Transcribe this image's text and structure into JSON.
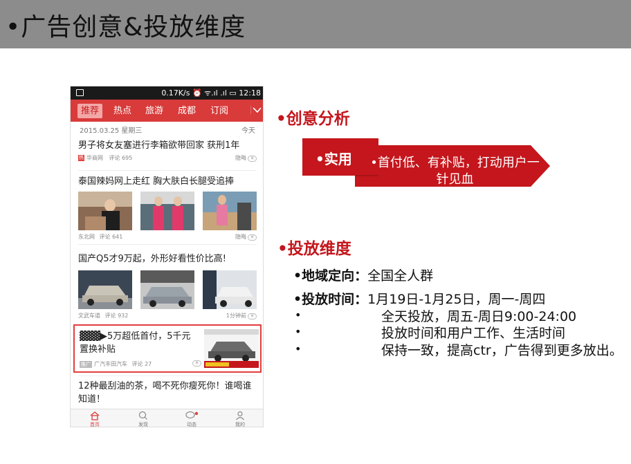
{
  "slide": {
    "title": "•广告创意&投放维度"
  },
  "phone": {
    "status": {
      "text": "0.17K/s ⏰ ᯤ.ıl .ıl ▭ 12:18"
    },
    "nav_tabs": [
      "推荐",
      "热点",
      "旅游",
      "成都",
      "订阅"
    ],
    "date_left": "2015.03.25   星期三",
    "date_right": "今天",
    "news": [
      {
        "title": "男子将女友塞进行李箱欲带回家 获刑1年",
        "source": "华商网",
        "comments": "评论 695",
        "tag": "热",
        "right": "隐晦"
      },
      {
        "title": "泰国辣妈网上走红 胸大肤白长腿受追捧",
        "source": "东北网",
        "comments": "评论 641",
        "right": "隐晦"
      },
      {
        "title": "国产Q5才9万起，外形好看性价比高!",
        "source": "文武车道",
        "comments": "评论 932",
        "right": "1分钟前"
      }
    ],
    "ad": {
      "title": "▓▓▓▶5万超低首付，5千元置换补贴",
      "tag": "推广",
      "source": "广汽丰田汽车",
      "comments": "评论 27"
    },
    "last_news": "12种最刮油的茶，喝不死你瘦死你！谁喝谁知道！",
    "tabbar": [
      "首页",
      "发现",
      "动态",
      "我的"
    ]
  },
  "creative": {
    "heading": "•创意分析",
    "label": "•实用",
    "text": "•首付低、有补贴，打动用户一针见血"
  },
  "placement": {
    "heading": "•投放维度",
    "geo_label": "•地域定向：",
    "geo_value": "全国全人群",
    "time_label": "•投放时间：",
    "time_value": "1月19日-1月25日，周一-周四",
    "line2": "全天投放，周五-周日9:00-24:00",
    "line3": "投放时间和用户工作、生活时间",
    "line4": "保持一致，提高ctr，广告得到更多放出。",
    "bullet": "•"
  },
  "colors": {
    "header_gray": "#8c8c8c",
    "brand_red": "#c4161c",
    "nav_red": "#d93a3a"
  }
}
